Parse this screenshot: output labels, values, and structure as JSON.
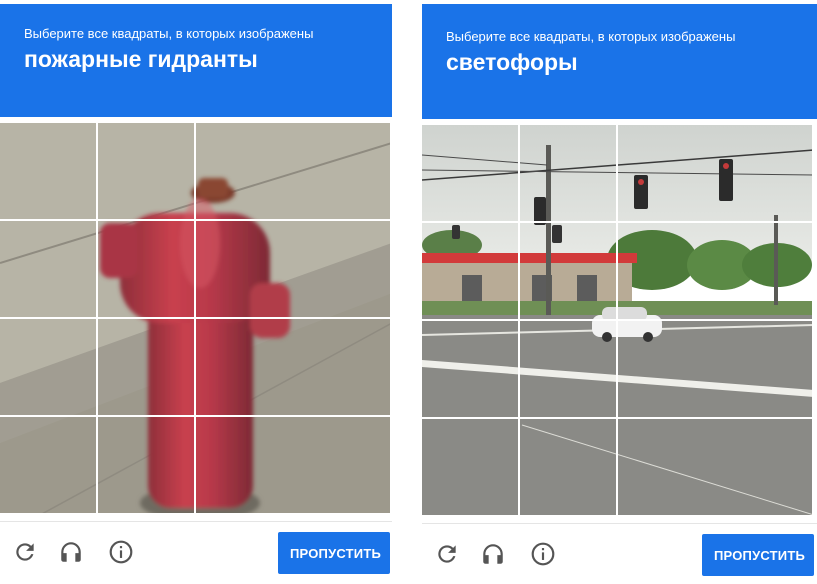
{
  "captchas": [
    {
      "prompt": "Выберите все квадраты, в которых изображены",
      "target": "пожарные гидранты",
      "skip_label": "ПРОПУСТИТЬ",
      "tiles": 16
    },
    {
      "prompt": "Выберите все квадраты, в которых изображены",
      "target": "светофоры",
      "skip_label": "ПРОПУСТИТЬ",
      "tiles": 16
    }
  ],
  "toolbar_icons": [
    "reload-icon",
    "audio-headphones-icon",
    "info-icon"
  ],
  "colors": {
    "accent": "#1a73e8",
    "icon": "#555555"
  }
}
